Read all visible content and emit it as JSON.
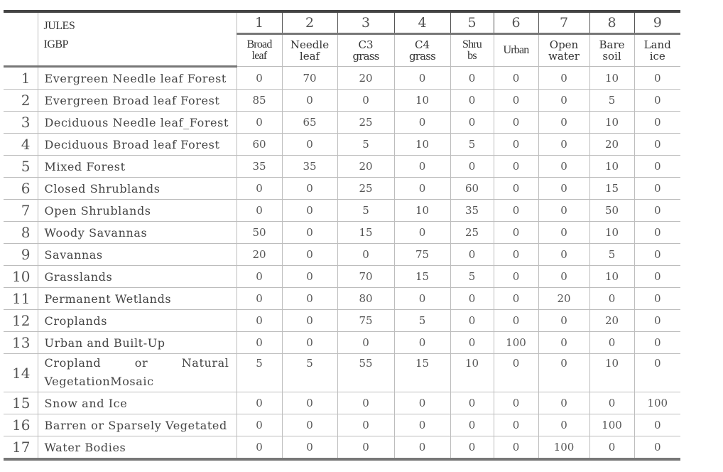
{
  "table": {
    "corner": {
      "jules_label": "JULES",
      "igbp_label": "IGBP"
    },
    "columns": [
      {
        "num": "1",
        "label_l1": "Broad",
        "label_l2": "leaf"
      },
      {
        "num": "2",
        "label_l1": "Needle",
        "label_l2": "leaf"
      },
      {
        "num": "3",
        "label_l1": "C3",
        "label_l2": "grass"
      },
      {
        "num": "4",
        "label_l1": "C4",
        "label_l2": "grass"
      },
      {
        "num": "5",
        "label_l1": "Shru",
        "label_l2": "bs"
      },
      {
        "num": "6",
        "label_l1": "Urban",
        "label_l2": ""
      },
      {
        "num": "7",
        "label_l1": "Open",
        "label_l2": "water"
      },
      {
        "num": "8",
        "label_l1": "Bare",
        "label_l2": "soil"
      },
      {
        "num": "9",
        "label_l1": "Land",
        "label_l2": "ice"
      }
    ],
    "rows": [
      {
        "idx": "1",
        "name": "Evergreen Needle leaf Forest",
        "values": [
          "0",
          "70",
          "20",
          "0",
          "0",
          "0",
          "0",
          "10",
          "0"
        ]
      },
      {
        "idx": "2",
        "name": "Evergreen Broad leaf Forest",
        "values": [
          "85",
          "0",
          "0",
          "10",
          "0",
          "0",
          "0",
          "5",
          "0"
        ]
      },
      {
        "idx": "3",
        "name": "Deciduous Needle leaf_Forest",
        "values": [
          "0",
          "65",
          "25",
          "0",
          "0",
          "0",
          "0",
          "10",
          "0"
        ]
      },
      {
        "idx": "4",
        "name": "Deciduous Broad leaf Forest",
        "values": [
          "60",
          "0",
          "5",
          "10",
          "5",
          "0",
          "0",
          "20",
          "0"
        ]
      },
      {
        "idx": "5",
        "name": "Mixed Forest",
        "values": [
          "35",
          "35",
          "20",
          "0",
          "0",
          "0",
          "0",
          "10",
          "0"
        ]
      },
      {
        "idx": "6",
        "name": "Closed Shrublands",
        "values": [
          "0",
          "0",
          "25",
          "0",
          "60",
          "0",
          "0",
          "15",
          "0"
        ]
      },
      {
        "idx": "7",
        "name": "Open Shrublands",
        "values": [
          "0",
          "0",
          "5",
          "10",
          "35",
          "0",
          "0",
          "50",
          "0"
        ]
      },
      {
        "idx": "8",
        "name": "Woody Savannas",
        "values": [
          "50",
          "0",
          "15",
          "0",
          "25",
          "0",
          "0",
          "10",
          "0"
        ]
      },
      {
        "idx": "9",
        "name": "Savannas",
        "values": [
          "20",
          "0",
          "0",
          "75",
          "0",
          "0",
          "0",
          "5",
          "0"
        ]
      },
      {
        "idx": "10",
        "name": "Grasslands",
        "values": [
          "0",
          "0",
          "70",
          "15",
          "5",
          "0",
          "0",
          "10",
          "0"
        ]
      },
      {
        "idx": "11",
        "name": "Permanent Wetlands",
        "values": [
          "0",
          "0",
          "80",
          "0",
          "0",
          "0",
          "20",
          "0",
          "0"
        ]
      },
      {
        "idx": "12",
        "name": "Croplands",
        "values": [
          "0",
          "0",
          "75",
          "5",
          "0",
          "0",
          "0",
          "20",
          "0"
        ]
      },
      {
        "idx": "13",
        "name": "Urban and Built-Up",
        "values": [
          "0",
          "0",
          "0",
          "0",
          "0",
          "100",
          "0",
          "0",
          "0"
        ]
      },
      {
        "idx": "14",
        "name_l1_a": "Cropland",
        "name_l1_b": "or",
        "name_l1_c": "Natural",
        "name_l2": "VegetationMosaic",
        "values": [
          "5",
          "5",
          "55",
          "15",
          "10",
          "0",
          "0",
          "10",
          "0"
        ]
      },
      {
        "idx": "15",
        "name": "Snow and Ice",
        "values": [
          "0",
          "0",
          "0",
          "0",
          "0",
          "0",
          "0",
          "0",
          "100"
        ]
      },
      {
        "idx": "16",
        "name": "Barren or Sparsely Vegetated",
        "values": [
          "0",
          "0",
          "0",
          "0",
          "0",
          "0",
          "0",
          "100",
          "0"
        ]
      },
      {
        "idx": "17",
        "name": "Water Bodies",
        "values": [
          "0",
          "0",
          "0",
          "0",
          "0",
          "0",
          "100",
          "0",
          "0"
        ]
      }
    ]
  }
}
